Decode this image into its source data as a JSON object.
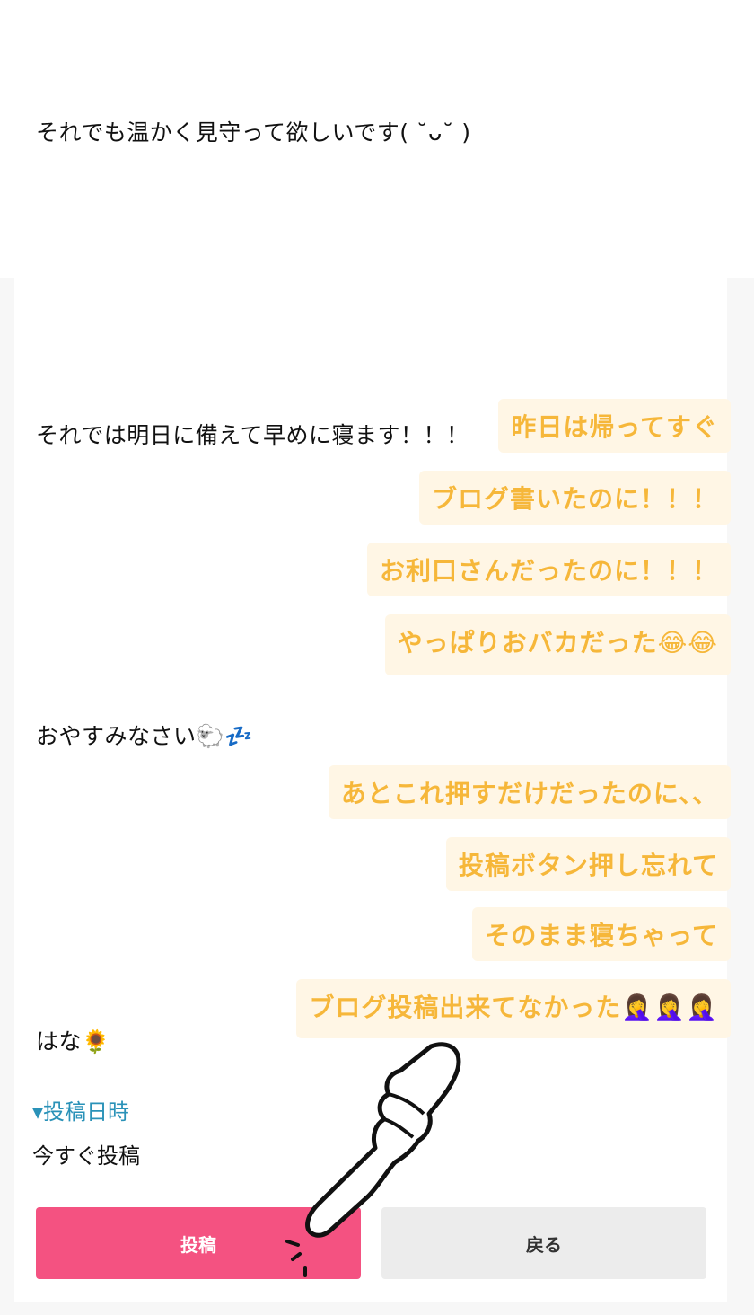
{
  "blog_body": {
    "line1": "それでも温かく見守って欲しいです( ˘ᴗ˘ )",
    "line2": "それでは明日に備えて早めに寝ます！！！",
    "line3": "おやすみなさい🐑💤",
    "line4": "はな🌻"
  },
  "captions": [
    "昨日は帰ってすぐ",
    "ブログ書いたのに！！！",
    "お利口さんだったのに！！！",
    "やっぱりおバカだった😂😂",
    "あとこれ押すだけだったのに、、",
    "投稿ボタン押し忘れて",
    "そのまま寝ちゃって",
    "ブログ投稿出来てなかった🤦‍♀️🤦‍♀️🤦‍♀️"
  ],
  "post_time": {
    "heading": "▾投稿日時",
    "value": "今すぐ投稿"
  },
  "actions": {
    "post_label": "投稿",
    "back_label": "戻る"
  },
  "colors": {
    "post_button": "#f45281",
    "caption_text": "#f6b73a",
    "section_heading": "#2a92b8"
  },
  "icons": [
    "hand-pointer-icon"
  ]
}
